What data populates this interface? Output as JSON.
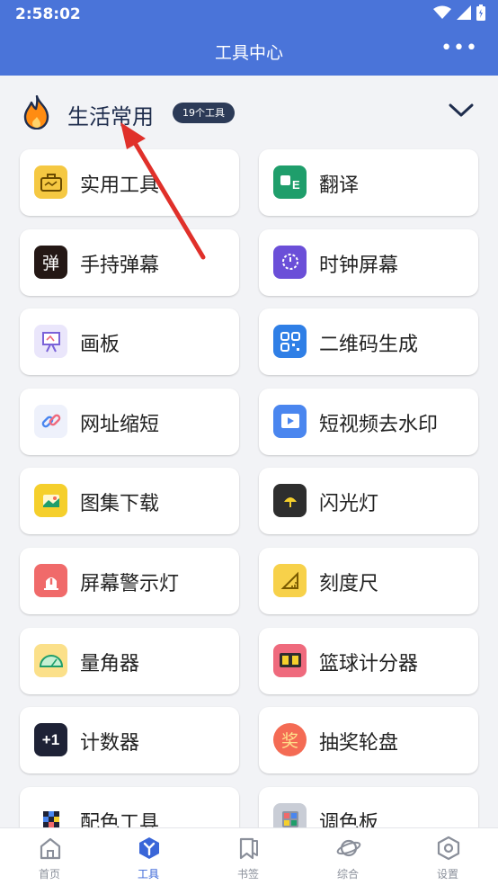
{
  "status_bar": {
    "time": "2:58:02"
  },
  "header": {
    "title": "工具中心",
    "more_label": "•••"
  },
  "section": {
    "title": "生活常用",
    "badge": "19个工具"
  },
  "tools": [
    {
      "label": "实用工具",
      "icon": "toolbox-icon",
      "color": "#f5c842"
    },
    {
      "label": "翻译",
      "icon": "translate-icon",
      "color": "#1f9e6b"
    },
    {
      "label": "手持弹幕",
      "icon": "danmaku-icon",
      "color": "#241815",
      "glyph": "弹"
    },
    {
      "label": "时钟屏幕",
      "icon": "clock-icon",
      "color": "#6b4fd8"
    },
    {
      "label": "画板",
      "icon": "easel-icon",
      "color": "#eae6fb"
    },
    {
      "label": "二维码生成",
      "icon": "qrcode-icon",
      "color": "#2f7fe6"
    },
    {
      "label": "网址缩短",
      "icon": "link-icon",
      "color": "#eef1fb"
    },
    {
      "label": "短视频去水印",
      "icon": "video-icon",
      "color": "#4a86ef"
    },
    {
      "label": "图集下载",
      "icon": "gallery-icon",
      "color": "#f5cf2c"
    },
    {
      "label": "闪光灯",
      "icon": "flashlight-icon",
      "color": "#2e2e2e"
    },
    {
      "label": "屏幕警示灯",
      "icon": "alarm-light-icon",
      "color": "#f06a6a"
    },
    {
      "label": "刻度尺",
      "icon": "ruler-icon",
      "color": "#f7d14a"
    },
    {
      "label": "量角器",
      "icon": "protractor-icon",
      "color": "#fbe08a"
    },
    {
      "label": "篮球计分器",
      "icon": "scoreboard-icon",
      "color": "#ef6a7d"
    },
    {
      "label": "计数器",
      "icon": "counter-icon",
      "color": "#1e2236",
      "glyph": "+1"
    },
    {
      "label": "抽奖轮盘",
      "icon": "lottery-icon",
      "color": "#f46b54",
      "glyph": "奖"
    },
    {
      "label": "配色工具",
      "icon": "color-grid-icon",
      "color": "#ffffff"
    },
    {
      "label": "调色板",
      "icon": "palette-icon",
      "color": "#c9cdd6"
    }
  ],
  "bottom_nav": [
    {
      "label": "首页",
      "icon": "home-icon"
    },
    {
      "label": "工具",
      "icon": "tools-icon",
      "active": true
    },
    {
      "label": "书签",
      "icon": "bookmark-icon"
    },
    {
      "label": "综合",
      "icon": "planet-icon"
    },
    {
      "label": "设置",
      "icon": "settings-icon"
    }
  ],
  "colors": {
    "primary": "#4a74d9",
    "badge": "#2c3a57",
    "annotation_arrow": "#e0302a"
  }
}
